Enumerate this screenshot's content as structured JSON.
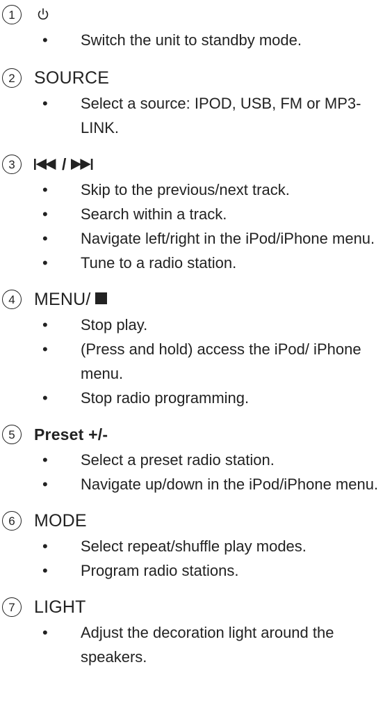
{
  "sections": [
    {
      "number": "1",
      "title": "",
      "icon": "power-icon",
      "items": [
        "Switch the unit to standby mode."
      ]
    },
    {
      "number": "2",
      "title": "SOURCE",
      "items": [
        "Select a source: IPOD, USB, FM or MP3-LINK."
      ]
    },
    {
      "number": "3",
      "title": "/",
      "icon": "skip-previous-next-icons",
      "items": [
        "Skip to the previous/next track.",
        "Search within a track.",
        "Navigate left/right in the iPod/iPhone menu.",
        "Tune to a radio station."
      ]
    },
    {
      "number": "4",
      "title": "MENU/",
      "icon": "stop-icon",
      "items": [
        "Stop play.",
        "(Press and hold) access the iPod/ iPhone menu.",
        "Stop radio programming."
      ]
    },
    {
      "number": "5",
      "title": "Preset +/-",
      "items": [
        "Select a preset radio station.",
        "Navigate up/down in the iPod/iPhone menu."
      ]
    },
    {
      "number": "6",
      "title": "MODE",
      "items": [
        "Select repeat/shuffle play modes.",
        "Program radio stations."
      ]
    },
    {
      "number": "7",
      "title": "LIGHT",
      "items": [
        "Adjust the decoration light around the speakers."
      ]
    }
  ]
}
